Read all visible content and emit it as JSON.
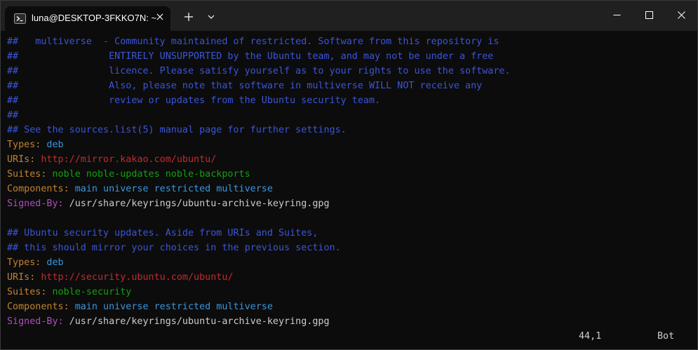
{
  "window": {
    "tab_title": "luna@DESKTOP-3FKKO7N: ~",
    "icons": {
      "tab": "terminal-icon",
      "close_tab": "close-icon",
      "new_tab": "plus-icon",
      "dropdown": "chevron-down-icon",
      "minimize": "minimize-icon",
      "maximize": "maximize-icon",
      "close": "close-icon"
    }
  },
  "colors": {
    "comment": "#3b55d9",
    "key": "#c1832f",
    "url": "#c8282d",
    "green": "#13a10e",
    "blue": "#3a96dd",
    "magenta": "#b04cc2",
    "text": "#cccccc",
    "background": "#0c0c0c",
    "titlebar": "#202020"
  },
  "lines": [
    {
      "parts": [
        {
          "t": "##   multiverse  - Community maintained of restricted. Software from this repository is",
          "c": "c-cmt"
        }
      ]
    },
    {
      "parts": [
        {
          "t": "##                ENTIRELY UNSUPPORTED by the Ubuntu team, and may not be under a free",
          "c": "c-cmt"
        }
      ]
    },
    {
      "parts": [
        {
          "t": "##                licence. Please satisfy yourself as to your rights to use the software.",
          "c": "c-cmt"
        }
      ]
    },
    {
      "parts": [
        {
          "t": "##                Also, please note that software in multiverse WILL NOT receive any",
          "c": "c-cmt"
        }
      ]
    },
    {
      "parts": [
        {
          "t": "##                review or updates from the Ubuntu security team.",
          "c": "c-cmt"
        }
      ]
    },
    {
      "parts": [
        {
          "t": "##",
          "c": "c-cmt"
        }
      ]
    },
    {
      "parts": [
        {
          "t": "## See the sources.list(5) manual page for further settings.",
          "c": "c-cmt"
        }
      ]
    },
    {
      "parts": [
        {
          "t": "Types:",
          "c": "c-key"
        },
        {
          "t": " deb",
          "c": "c-blu"
        }
      ]
    },
    {
      "parts": [
        {
          "t": "URIs:",
          "c": "c-key"
        },
        {
          "t": " http://mirror.kakao.com/ubuntu/",
          "c": "c-url"
        }
      ]
    },
    {
      "parts": [
        {
          "t": "Suites:",
          "c": "c-key"
        },
        {
          "t": " noble noble-updates noble-backports",
          "c": "c-grn"
        }
      ]
    },
    {
      "parts": [
        {
          "t": "Components:",
          "c": "c-key"
        },
        {
          "t": " main universe restricted multiverse",
          "c": "c-blu"
        }
      ]
    },
    {
      "parts": [
        {
          "t": "Signed-By:",
          "c": "c-mag"
        },
        {
          "t": " /usr/share/keyrings/ubuntu-archive-keyring.gpg",
          "c": "c-wht"
        }
      ]
    },
    {
      "parts": [
        {
          "t": "",
          "c": "c-wht"
        }
      ]
    },
    {
      "parts": [
        {
          "t": "## Ubuntu security updates. Aside from URIs and Suites,",
          "c": "c-cmt"
        }
      ]
    },
    {
      "parts": [
        {
          "t": "## this should mirror your choices in the previous section.",
          "c": "c-cmt"
        }
      ]
    },
    {
      "parts": [
        {
          "t": "Types:",
          "c": "c-key"
        },
        {
          "t": " deb",
          "c": "c-blu"
        }
      ]
    },
    {
      "parts": [
        {
          "t": "URIs:",
          "c": "c-key"
        },
        {
          "t": " http://security.ubuntu.com/ubuntu/",
          "c": "c-url"
        }
      ]
    },
    {
      "parts": [
        {
          "t": "Suites:",
          "c": "c-key"
        },
        {
          "t": " noble-security",
          "c": "c-grn"
        }
      ]
    },
    {
      "parts": [
        {
          "t": "Components:",
          "c": "c-key"
        },
        {
          "t": " main universe restricted multiverse",
          "c": "c-blu"
        }
      ]
    },
    {
      "parts": [
        {
          "t": "Signed-By:",
          "c": "c-mag"
        },
        {
          "t": " /usr/share/keyrings/ubuntu-archive-keyring.gpg",
          "c": "c-wht"
        }
      ]
    }
  ],
  "status": {
    "position": "44,1",
    "scroll": "Bot"
  }
}
